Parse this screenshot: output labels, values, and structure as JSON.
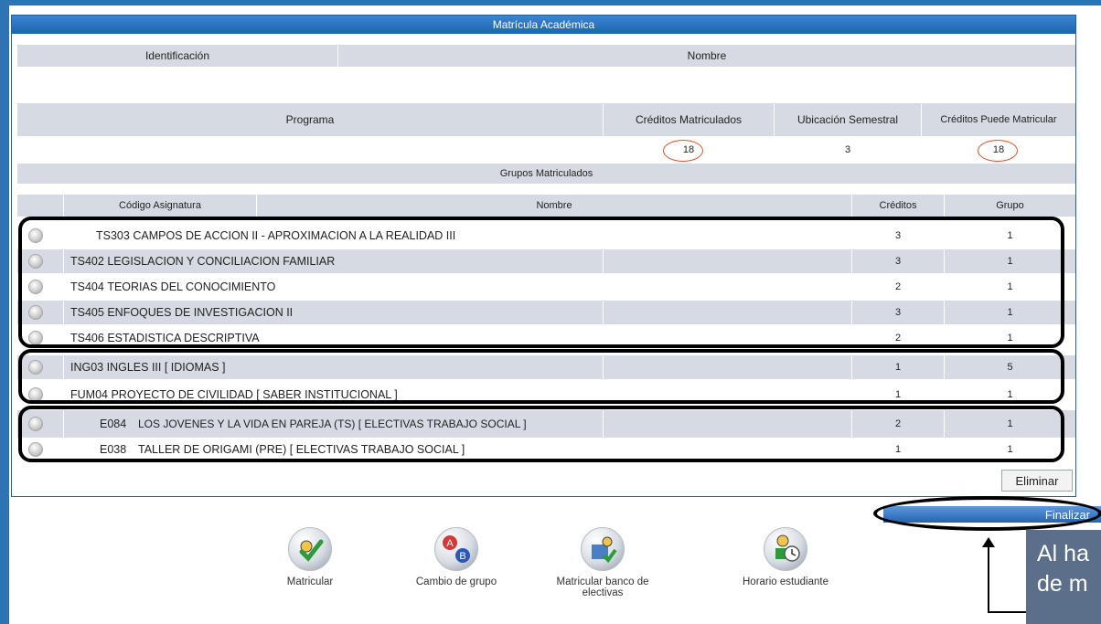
{
  "header": {
    "title": "Matrícula Académica"
  },
  "student": {
    "id_label": "Identificación",
    "name_label": "Nombre"
  },
  "summary": {
    "program_label": "Programa",
    "credits_enrolled_label": "Créditos Matriculados",
    "semester_label": "Ubicación Semestral",
    "credits_allowed_label": "Créditos Puede Matricular",
    "credits_enrolled": "18",
    "semester": "3",
    "credits_allowed": "18"
  },
  "groups": {
    "title": "Grupos Matriculados",
    "columns": {
      "code": "Código Asignatura",
      "name": "Nombre",
      "credits": "Créditos",
      "group": "Grupo"
    },
    "rows": [
      {
        "code": "TS303",
        "name": "CAMPOS DE ACCION II - APROXIMACION A LA REALIDAD III",
        "credits": "3",
        "group": "1"
      },
      {
        "code": "TS402",
        "name": "LEGISLACION Y CONCILIACION FAMILIAR",
        "credits": "3",
        "group": "1"
      },
      {
        "code": "TS404",
        "name": "TEORIAS DEL CONOCIMIENTO",
        "credits": "2",
        "group": "1"
      },
      {
        "code": "TS405",
        "name": "ENFOQUES DE INVESTIGACION II",
        "credits": "3",
        "group": "1"
      },
      {
        "code": "TS406",
        "name": "ESTADISTICA DESCRIPTIVA",
        "credits": "2",
        "group": "1"
      },
      {
        "code": "ING03",
        "name": "INGLES III [ IDIOMAS ]",
        "credits": "1",
        "group": "5"
      },
      {
        "code": "FUM04",
        "name": "PROYECTO DE CIVILIDAD [ SABER INSTITUCIONAL ]",
        "credits": "1",
        "group": "1"
      },
      {
        "code": "E084",
        "name": "LOS JOVENES Y LA VIDA EN PAREJA (TS) [ ELECTIVAS TRABAJO SOCIAL ]",
        "credits": "2",
        "group": "1"
      },
      {
        "code": "E038",
        "name": "TALLER DE ORIGAMI (PRE) [ ELECTIVAS TRABAJO SOCIAL ]",
        "credits": "1",
        "group": "1"
      }
    ]
  },
  "actions": {
    "delete": "Eliminar",
    "finish": "Finalizar"
  },
  "toolbar": [
    {
      "label": "Matricular",
      "icon": "check-icon"
    },
    {
      "label": "Cambio de grupo",
      "icon": "swap-ab-icon"
    },
    {
      "label": "Matricular banco de electivas",
      "icon": "enroll-electives-icon"
    },
    {
      "label": "Horario estudiante",
      "icon": "schedule-clock-icon"
    }
  ],
  "callout": {
    "text": "Al ha de m"
  },
  "colors": {
    "accent": "#1f63b0",
    "highlight_circle": "#e2502a",
    "row_gray": "#d6dbe3"
  }
}
